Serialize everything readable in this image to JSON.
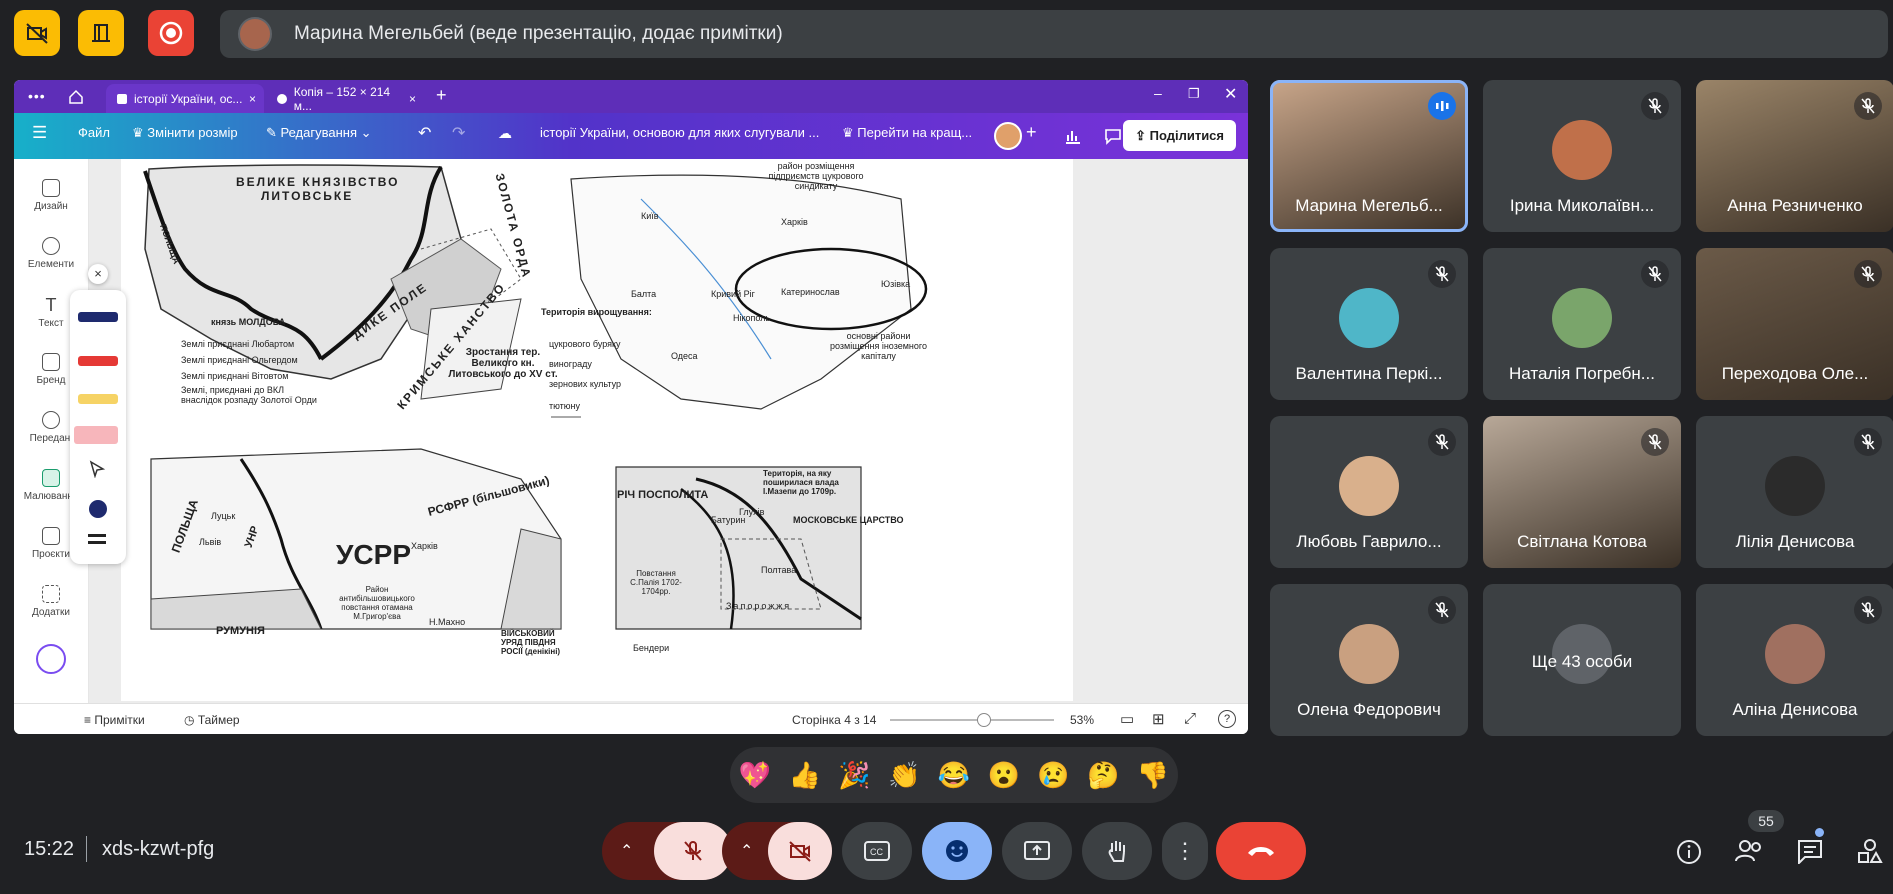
{
  "top_left_buttons": [
    {
      "name": "camera-off-icon",
      "bg": "#fbbc04"
    },
    {
      "name": "building-icon",
      "bg": "#fbbc04"
    },
    {
      "name": "record-icon",
      "bg": "#ea4335"
    }
  ],
  "presenter": {
    "title": "Марина Мегельбей (веде презентацію, додає примітки)"
  },
  "browser": {
    "tabs": [
      {
        "label": "історії України, ос..."
      },
      {
        "label": "Копія – 152 × 214 м..."
      }
    ]
  },
  "canva": {
    "menu_label": "Файл",
    "resize_label": "Змінити розмір",
    "edit_label": "Редагування",
    "doc_title": "історії України, основою для яких слугували ...",
    "upgrade_label": "Перейти на кращ...",
    "share_label": "Поділитися",
    "rail": [
      {
        "icon": "layout-icon",
        "label": "Дизайн"
      },
      {
        "icon": "shapes-icon",
        "label": "Елементи"
      },
      {
        "icon": "text-icon",
        "label": "Текст"
      },
      {
        "icon": "brand-icon",
        "label": "Бренд"
      },
      {
        "icon": "cloud-upload-icon",
        "label": "Передані"
      },
      {
        "icon": "draw-icon",
        "label": "Малювання"
      },
      {
        "icon": "folder-icon",
        "label": "Проєкти"
      },
      {
        "icon": "apps-icon",
        "label": "Додатки"
      }
    ],
    "status": {
      "notes": "Примітки",
      "timer": "Таймер",
      "page": "Сторінка 4 з 14",
      "zoom": "53%",
      "zoom_level": 0.53
    }
  },
  "map": {
    "labels": {
      "gdl": "ВЕЛИКЕ КНЯЗІВСТВО",
      "gdl2": "ЛИТОВСЬКЕ",
      "horde": "ЗОЛОТА ОРДА",
      "wild": "ДИКЕ ПОЛЕ",
      "crimea": "КРИМСЬКЕ ХАНСТВО",
      "poland": "ПОЛЬЩА",
      "moldova": "князь МОЛДОВА",
      "growth": "Зростання тер. Великого кн. Литовського до XV ст.",
      "legend1": "Землі приєднані Любартом",
      "legend2": "Землі приєднані Ольгердом",
      "legend3": "Землі приєднані Вітовтом",
      "legend4": "Землі, приєднані до ВКЛ внаслідок розпаду Золотої Орди",
      "sugar": "район розміщення підприємств цукрового синдикату",
      "territory": "Територія вирощування:",
      "beet": "цукрового буряку",
      "grapes": "винограду",
      "grain": "зернових культур",
      "tobacco": "тютюну",
      "foreign": "основні райони розміщення іноземного капіталу",
      "kharkiv": "Харків",
      "kyiv": "Київ",
      "yuzivka": "Юзівка",
      "kryvyi": "Кривий Ріг",
      "nikopol": "Нікополь",
      "katerynoslav": "Катеринослав",
      "odesa": "Одеса",
      "balta": "Балта",
      "ussr": "УСРР",
      "rsfsr": "РСФРР (більшовики)",
      "polshcha": "ПОЛЬЩА",
      "romania": "РУМУНІЯ",
      "unr": "УНР",
      "kharkiv2": "Харків",
      "makhno": "Н.Махно",
      "hryhoriiv": "Район антибільшовицького повстання отамана М.Григор'єва",
      "south": "ВІЙСЬКОВИЙ УРЯД ПІВДНЯ РОСІЇ (денікіні)",
      "rich": "РІЧ ПОСПОЛИТА",
      "moscow": "МОСКОВСЬКЕ ЦАРСТВО",
      "mazepa": "Територія, на яку поширилася влада І.Мазепи до 1709р.",
      "zaporizhzhia": "Запорожжя",
      "baturyn": "Батурин",
      "hlukhiv": "Глухів",
      "poltava": "Полтава",
      "paliy": "Повстання С.Палія 1702-1704рр.",
      "bendery": "Бендери",
      "lviv": "Львів",
      "lutsk": "Луцьк"
    }
  },
  "participants": [
    {
      "name": "Марина Мегельб...",
      "video": true,
      "speaking": true,
      "avatar_color": "#c9a68a"
    },
    {
      "name": "Ірина Миколаївн...",
      "video": false,
      "muted": true,
      "avatar_color": "#c0704a"
    },
    {
      "name": "Анна Резниченко",
      "video": true,
      "muted": true,
      "avatar_color": "#9a8468"
    },
    {
      "name": "Валентина Перкі...",
      "video": false,
      "muted": true,
      "avatar_color": "#4fb6c8"
    },
    {
      "name": "Наталія Погребн...",
      "video": false,
      "muted": true,
      "avatar_color": "#7aa56b"
    },
    {
      "name": "Переходова Оле...",
      "video": true,
      "muted": true,
      "avatar_color": "#6b5a48"
    },
    {
      "name": "Любовь Гаврило...",
      "video": false,
      "muted": true,
      "avatar_color": "#d9b08c"
    },
    {
      "name": "Світлана Котова",
      "video": true,
      "muted": true,
      "avatar_color": "#b8a898"
    },
    {
      "name": "Лілія Денисова",
      "video": false,
      "muted": true,
      "avatar_color": "#2b2b2b"
    },
    {
      "name": "Олена Федорович",
      "video": false,
      "muted": true,
      "avatar_color": "#c9a080"
    },
    {
      "name": "Ще 43 особи",
      "video": false,
      "muted": false,
      "avatar_color": "#5f6368"
    },
    {
      "name": "Аліна Денисова",
      "video": false,
      "muted": true,
      "avatar_color": "#a07060"
    }
  ],
  "reactions": [
    "💖",
    "👍",
    "🎉",
    "👏",
    "😂",
    "😮",
    "😢",
    "🤔",
    "👎"
  ],
  "meeting": {
    "time": "15:22",
    "code": "xds-kzwt-pfg",
    "people_count": "55"
  },
  "colors": {
    "bg": "#202124",
    "tile": "#3c4043",
    "end_call": "#ea4335",
    "active_blue": "#8ab4f8",
    "mic_off": "#f9dedc"
  }
}
